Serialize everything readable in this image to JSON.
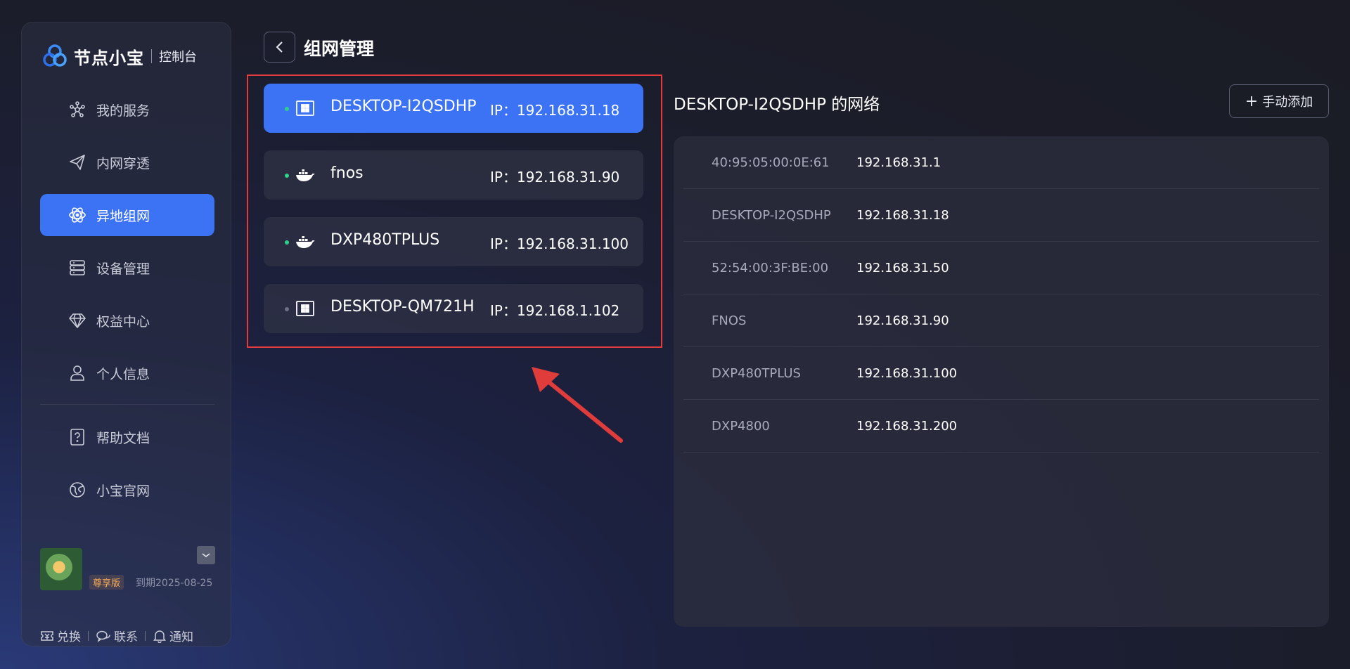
{
  "app": {
    "brand_name": "节点小宝",
    "brand_sub": "控制台"
  },
  "sidebar": {
    "items": [
      {
        "label": "我的服务",
        "icon": "nodes-icon"
      },
      {
        "label": "内网穿透",
        "icon": "paper-plane-icon"
      },
      {
        "label": "异地组网",
        "icon": "atom-icon",
        "active": true
      },
      {
        "label": "设备管理",
        "icon": "server-icon"
      },
      {
        "label": "权益中心",
        "icon": "diamond-icon"
      },
      {
        "label": "个人信息",
        "icon": "user-icon"
      },
      {
        "label": "帮助文档",
        "icon": "help-doc-icon"
      },
      {
        "label": "小宝官网",
        "icon": "globe-icon"
      }
    ],
    "user": {
      "tier": "尊享版",
      "expire": "到期2025-08-25"
    },
    "footer": {
      "redeem": "兑换",
      "contact": "联系",
      "notify": "通知"
    }
  },
  "header": {
    "title": "组网管理"
  },
  "devices": [
    {
      "name": "DESKTOP-I2QSDHP",
      "ip": "IP：192.168.31.18",
      "type": "windows-icon",
      "status": "online",
      "active": true
    },
    {
      "name": "fnos",
      "ip": "IP：192.168.31.90",
      "type": "docker-icon",
      "status": "online"
    },
    {
      "name": "DXP480TPLUS",
      "ip": "IP：192.168.31.100",
      "type": "docker-icon",
      "status": "online"
    },
    {
      "name": "DESKTOP-QM721H",
      "ip": "IP：192.168.1.102",
      "type": "windows-icon",
      "status": "offline"
    }
  ],
  "network": {
    "title": "DESKTOP-I2QSDHP 的网络",
    "add_label": "手动添加",
    "rows": [
      {
        "name": "40:95:05:00:0E:61",
        "ip": "192.168.31.1"
      },
      {
        "name": "DESKTOP-I2QSDHP",
        "ip": "192.168.31.18"
      },
      {
        "name": "52:54:00:3F:BE:00",
        "ip": "192.168.31.50"
      },
      {
        "name": "FNOS",
        "ip": "192.168.31.90"
      },
      {
        "name": "DXP480TPLUS",
        "ip": "192.168.31.100"
      },
      {
        "name": "DXP4800",
        "ip": "192.168.31.200"
      }
    ]
  },
  "colors": {
    "accent": "#3b73f4",
    "online": "#2fd18a",
    "offline": "#6e7388",
    "highlight": "#e03c3c"
  }
}
